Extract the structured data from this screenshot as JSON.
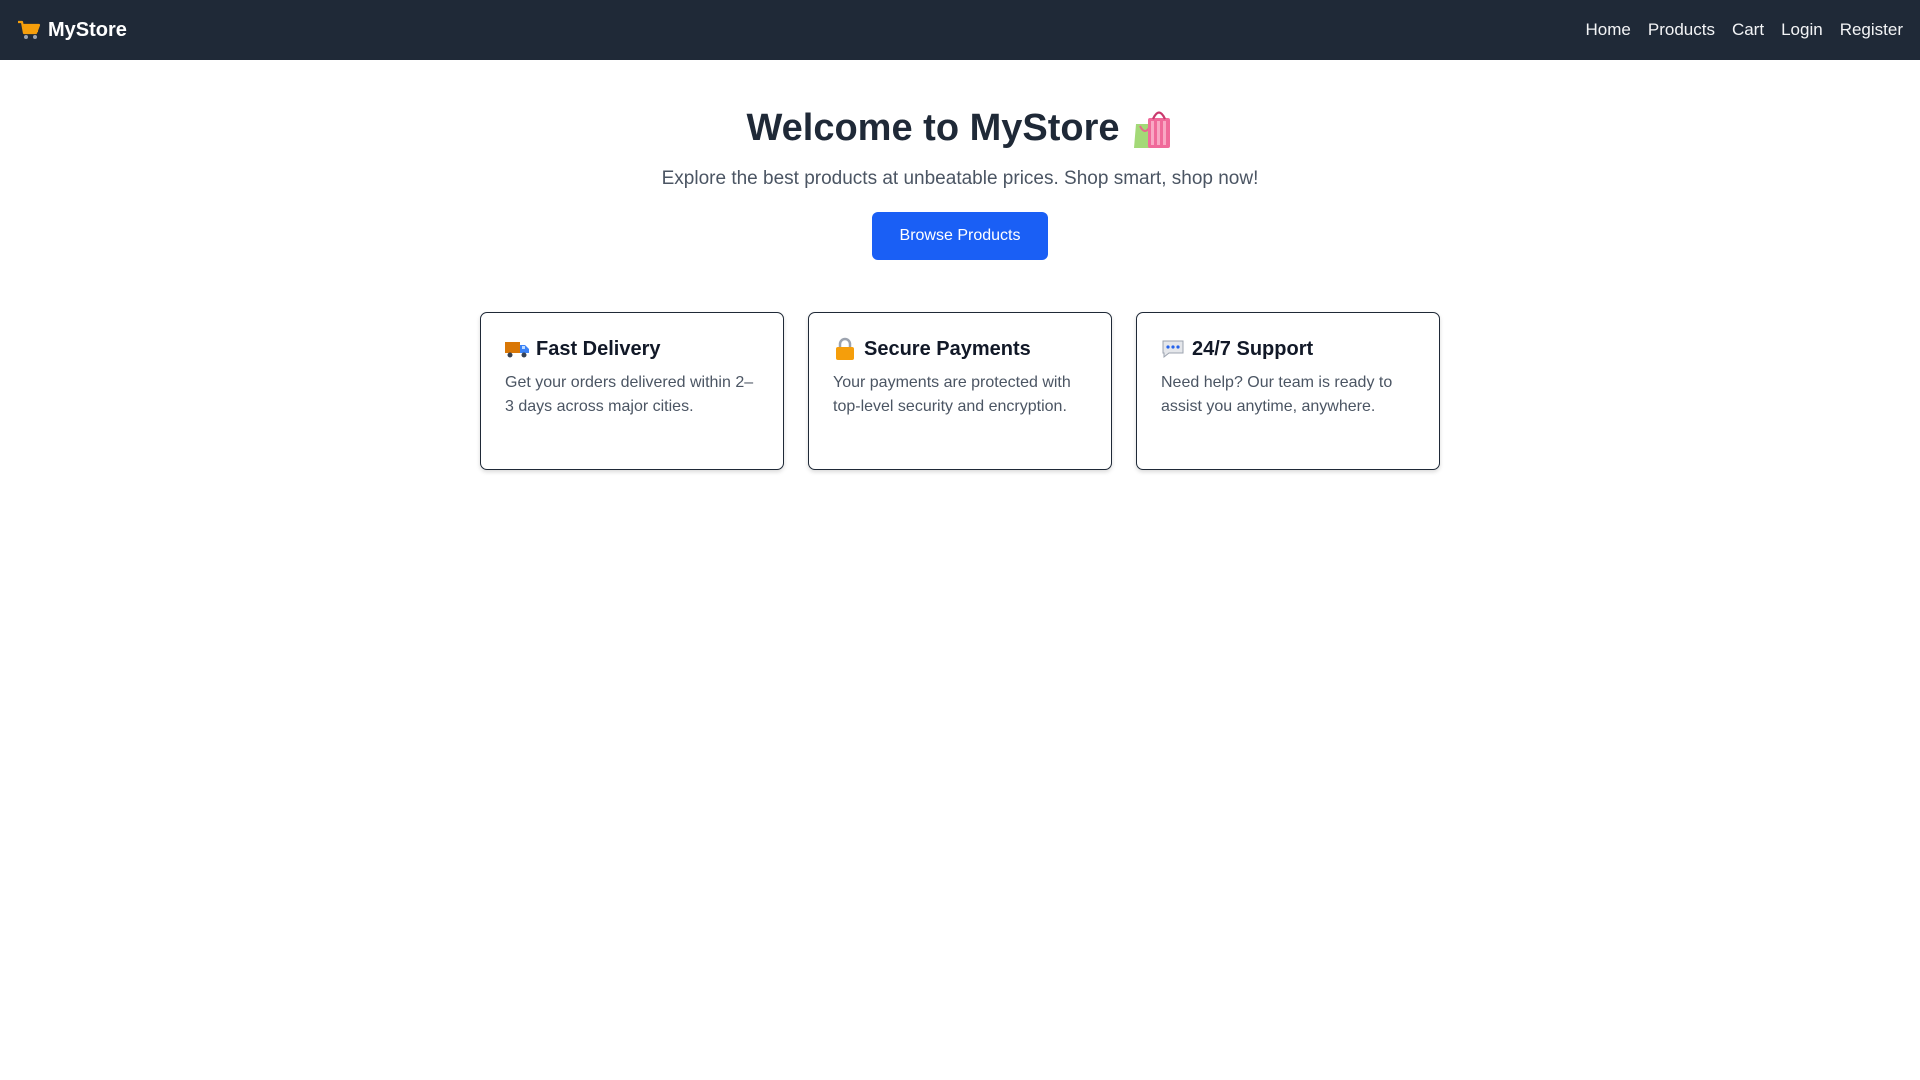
{
  "nav": {
    "brand": "MyStore",
    "brand_icon": "shopping-cart-icon",
    "links": [
      "Home",
      "Products",
      "Cart",
      "Login",
      "Register"
    ]
  },
  "hero": {
    "title": "Welcome to MyStore",
    "title_icon": "shopping-bags-icon",
    "subtitle": "Explore the best products at unbeatable prices. Shop smart, shop now!",
    "button": "Browse Products"
  },
  "features": [
    {
      "icon": "delivery-truck-icon",
      "title": "Fast Delivery",
      "text": "Get your orders delivered within 2–3 days across major cities."
    },
    {
      "icon": "lock-icon",
      "title": "Secure Payments",
      "text": "Your payments are protected with top-level security and encryption."
    },
    {
      "icon": "speech-bubble-icon",
      "title": "24/7 Support",
      "text": "Need help? Our team is ready to assist you anytime, anywhere."
    }
  ],
  "colors": {
    "navbar": "#1f2937",
    "primary": "#1a5ff5",
    "text_dark": "#1f2937",
    "text_muted": "#4b5563"
  }
}
